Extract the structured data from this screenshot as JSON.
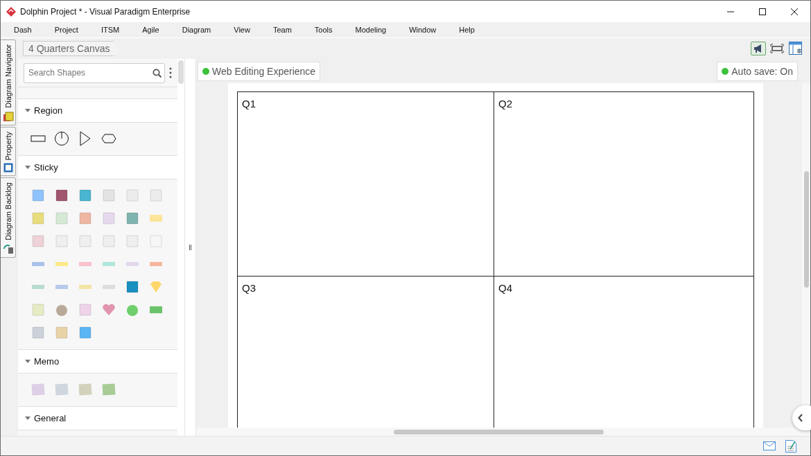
{
  "window": {
    "title": "Dolphin Project * - Visual Paradigm Enterprise"
  },
  "menu": [
    "Dash",
    "Project",
    "ITSM",
    "Agile",
    "Diagram",
    "View",
    "Team",
    "Tools",
    "Modeling",
    "Window",
    "Help"
  ],
  "side_tabs": [
    {
      "label": "Diagram Navigator"
    },
    {
      "label": "Property"
    },
    {
      "label": "Diagram Backlog"
    }
  ],
  "breadcrumb": "4 Quarters Canvas",
  "palette": {
    "search": {
      "placeholder": "Search Shapes"
    },
    "sections": [
      {
        "title": "Region",
        "kind": "region"
      },
      {
        "title": "Sticky",
        "kind": "sticky"
      },
      {
        "title": "Memo",
        "kind": "memo"
      },
      {
        "title": "General",
        "kind": "general"
      }
    ]
  },
  "web_editing": {
    "label": "Web Editing Experience"
  },
  "auto_save": {
    "label": "Auto save: On"
  },
  "canvas": {
    "quadrants": [
      "Q1",
      "Q2",
      "Q3",
      "Q4"
    ]
  }
}
